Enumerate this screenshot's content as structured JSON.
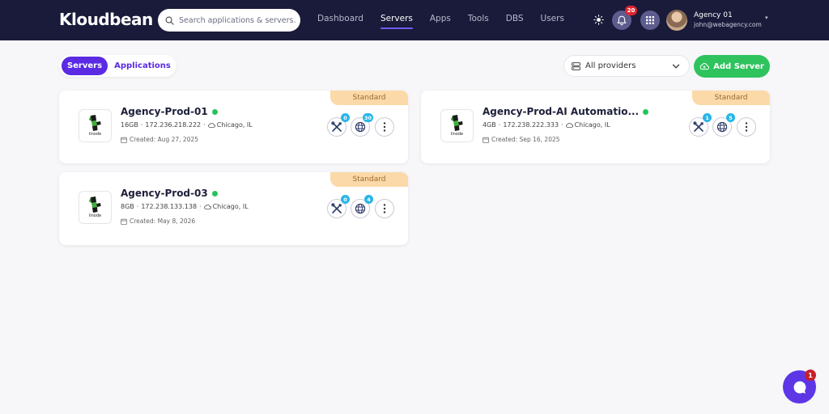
{
  "brand": {
    "logo_text": "Kloudbean"
  },
  "search": {
    "placeholder": "Search applications & servers..."
  },
  "nav": {
    "items": [
      "Dashboard",
      "Servers",
      "Apps",
      "Tools",
      "DBS",
      "Users"
    ],
    "active": "Servers"
  },
  "header_icons": {
    "theme": "sun-icon",
    "notifications": "bell-icon",
    "notifications_count": "20",
    "apps": "grid-icon"
  },
  "account": {
    "name": "Agency 01",
    "email": "john@webagency.com"
  },
  "toggle": {
    "servers_label": "Servers",
    "applications_label": "Applications",
    "selected": "Servers"
  },
  "filter": {
    "providers_label": "All providers"
  },
  "actions": {
    "add_server_label": "Add Server"
  },
  "servers": [
    {
      "name": "Agency-Prod-01",
      "status": "online",
      "ram": "16GB",
      "ip": "172.236.218.222",
      "location": "Chicago, IL",
      "created": "Created: Aug 27, 2025",
      "plan": "Standard",
      "provider_logo_text": "linode",
      "tools_count": "0",
      "sites_count": "30"
    },
    {
      "name": "Agency-Prod-AI Automatio...",
      "status": "online",
      "ram": "4GB",
      "ip": "172.238.222.333",
      "location": "Chicago, IL",
      "created": "Created: Sep 16, 2025",
      "plan": "Standard",
      "provider_logo_text": "linode",
      "tools_count": "1",
      "sites_count": "5"
    },
    {
      "name": "Agency-Prod-03",
      "status": "online",
      "ram": "8GB",
      "ip": "172.238.133.138",
      "location": "Chicago, IL",
      "created": "Created: May 8, 2026",
      "plan": "Standard",
      "provider_logo_text": "linode",
      "tools_count": "0",
      "sites_count": "4"
    }
  ],
  "chat": {
    "unread": "1"
  },
  "colors": {
    "nav_bg": "#1a1b3a",
    "primary": "#5a2be3",
    "success": "#2ec35d",
    "plan_bg": "#fcd9a8",
    "count_badge": "#29b6e8",
    "notify_badge": "#e0242e"
  }
}
